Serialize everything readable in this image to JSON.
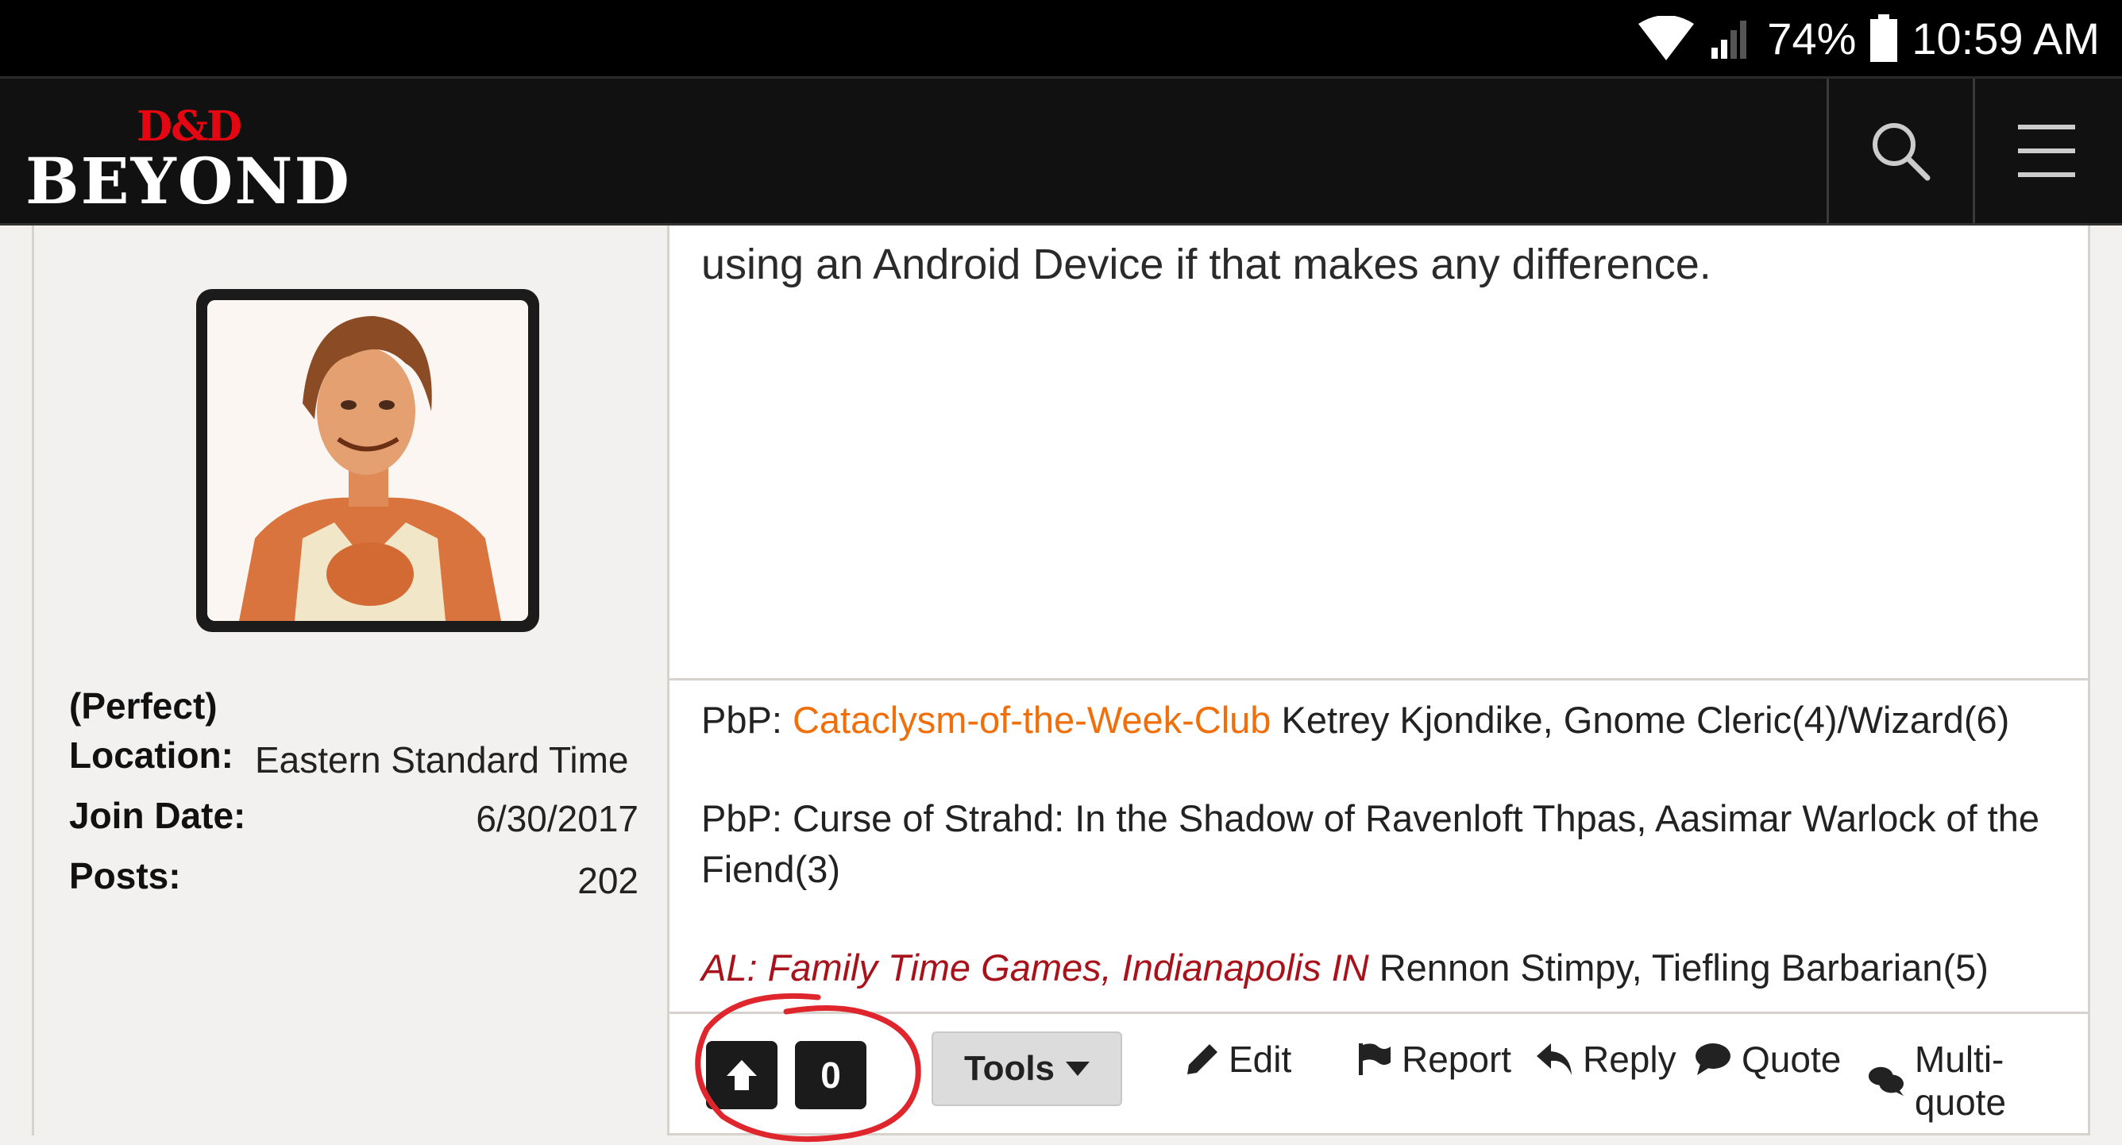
{
  "status_bar": {
    "battery": "74%",
    "time": "10:59 AM"
  },
  "header": {
    "logo_top": "D&D",
    "logo_bottom": "BEYOND",
    "search_icon": "search-icon",
    "menu_icon": "hamburger-menu-icon"
  },
  "post": {
    "text": "using an Android Device if that makes any difference."
  },
  "author": {
    "title": "(Perfect)",
    "location_label": "Location:",
    "location_value": "Eastern Standard Time",
    "join_label": "Join Date:",
    "join_value": "6/30/2017",
    "posts_label": "Posts:",
    "posts_value": "202"
  },
  "signature": {
    "line1_prefix": "PbP:",
    "line1_link": "Cataclysm-of-the-Week-Club",
    "line1_rest": "Ketrey Kjondike, Gnome Cleric(4)/Wizard(6)",
    "line2a": "PbP: Curse of Strahd: In the Shadow of Ravenloft Thpas, Aasimar Warlock of the",
    "line2b": "Fiend(3)",
    "line3_link": "AL: Family Time Games, Indianapolis IN",
    "line3_rest": "Rennon Stimpy, Tiefling Barbarian(5)"
  },
  "actions": {
    "vote_count": "0",
    "tools_label": "Tools",
    "edit_label": "Edit",
    "report_label": "Report",
    "reply_label": "Reply",
    "quote_label": "Quote",
    "multiquote_label": "Multi-quote"
  },
  "colors": {
    "link_orange": "#f06f0a",
    "link_red": "#a8121b",
    "annotation_red": "#e0262d",
    "brand_red": "#e40712"
  }
}
